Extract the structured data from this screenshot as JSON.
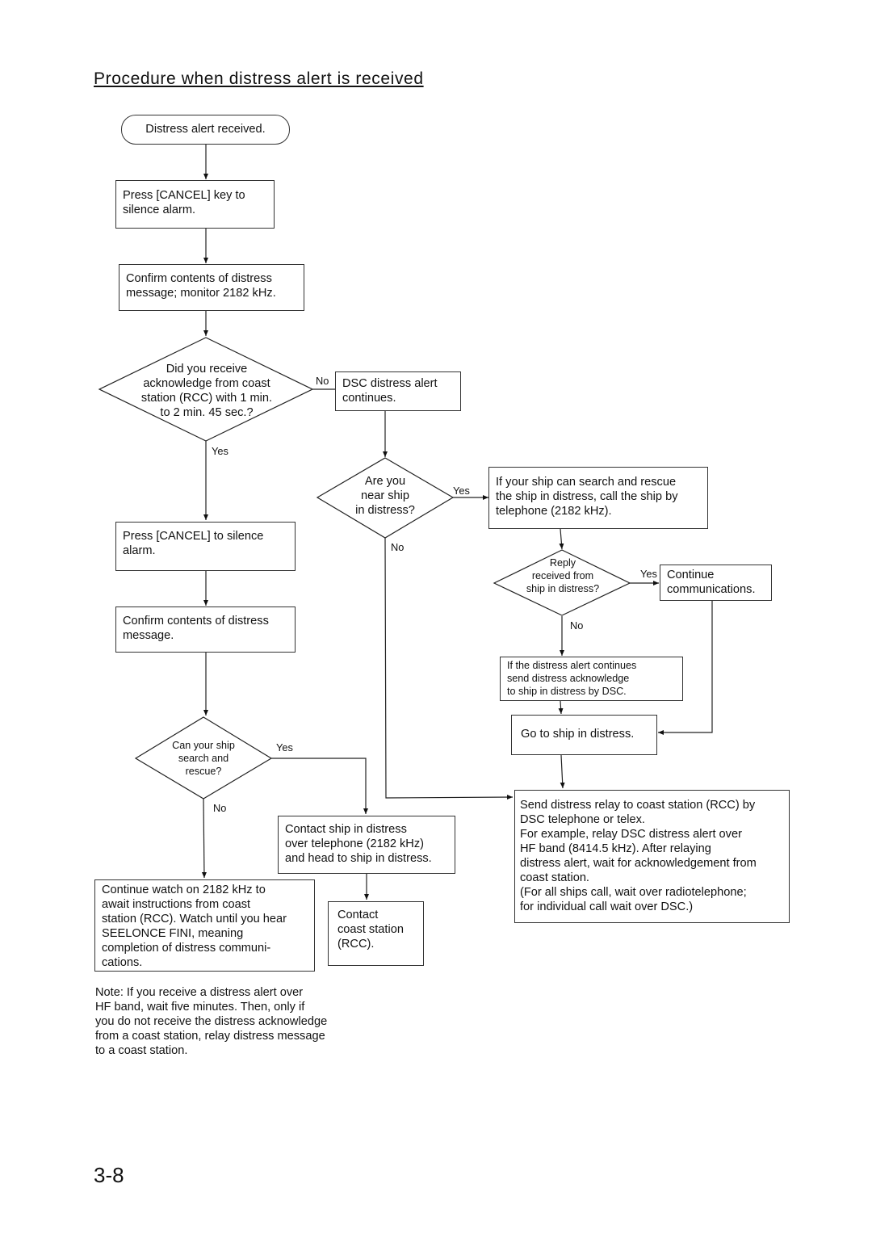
{
  "title": "Procedure when distress alert is received",
  "page_number": "3-8",
  "nodes": {
    "start": "Distress alert received.",
    "press_cancel_key": "Press [CANCEL] key to\nsilence alarm.",
    "confirm_monitor": "Confirm contents of distress\nmessage; monitor 2182 kHz.",
    "did_you_receive_ack": "Did you receive\nacknowledge from coast\nstation (RCC) with 1 min.\nto 2 min. 45 sec.?",
    "dsc_alert_continues": "DSC distress alert\ncontinues.",
    "are_you_near": "Are you\nnear ship\nin distress?",
    "if_ship_can_search": "If your ship can search and rescue\nthe ship in distress, call the ship by\ntelephone (2182 kHz).",
    "reply_received": "Reply\nreceived from\nship in distress?",
    "continue_comms": "Continue\ncommunications.",
    "send_ack_by_dsc": "If the distress alert continues\nsend distress acknowledge\nto ship in distress by DSC.",
    "go_to_ship": "Go to ship in distress.",
    "send_relay": "Send distress relay to coast station (RCC) by\nDSC telephone or telex.\nFor example, relay DSC distress alert over\nHF band (8414.5 kHz). After relaying\ndistress alert, wait for acknowledgement from\ncoast station.\n(For all ships call, wait over radiotelephone;\nfor individual call wait over DSC.)",
    "press_cancel_silence": "Press [CANCEL] to silence\nalarm.",
    "confirm_contents": "Confirm contents of distress\nmessage.",
    "can_your_ship": "Can your ship\nsearch and\nrescue?",
    "contact_ship_telephone": "Contact ship in distress\nover telephone (2182 kHz)\nand head to ship in distress.",
    "continue_watch": "Continue watch on 2182 kHz to\nawait instructions from coast\nstation (RCC). Watch until you hear\nSEELONCE FINI, meaning\ncompletion of distress communi-\ncations.",
    "contact_coast_station": "Contact\ncoast station\n(RCC)."
  },
  "labels": {
    "ack_no": "No",
    "ack_yes": "Yes",
    "near_yes": "Yes",
    "near_no": "No",
    "reply_yes": "Yes",
    "reply_no": "No",
    "can_yes": "Yes",
    "can_no": "No"
  },
  "note": "Note: If you receive a distress alert over\nHF band, wait five minutes. Then, only if\nyou do not receive the distress acknowledge\nfrom a coast station, relay distress message\nto a coast station."
}
